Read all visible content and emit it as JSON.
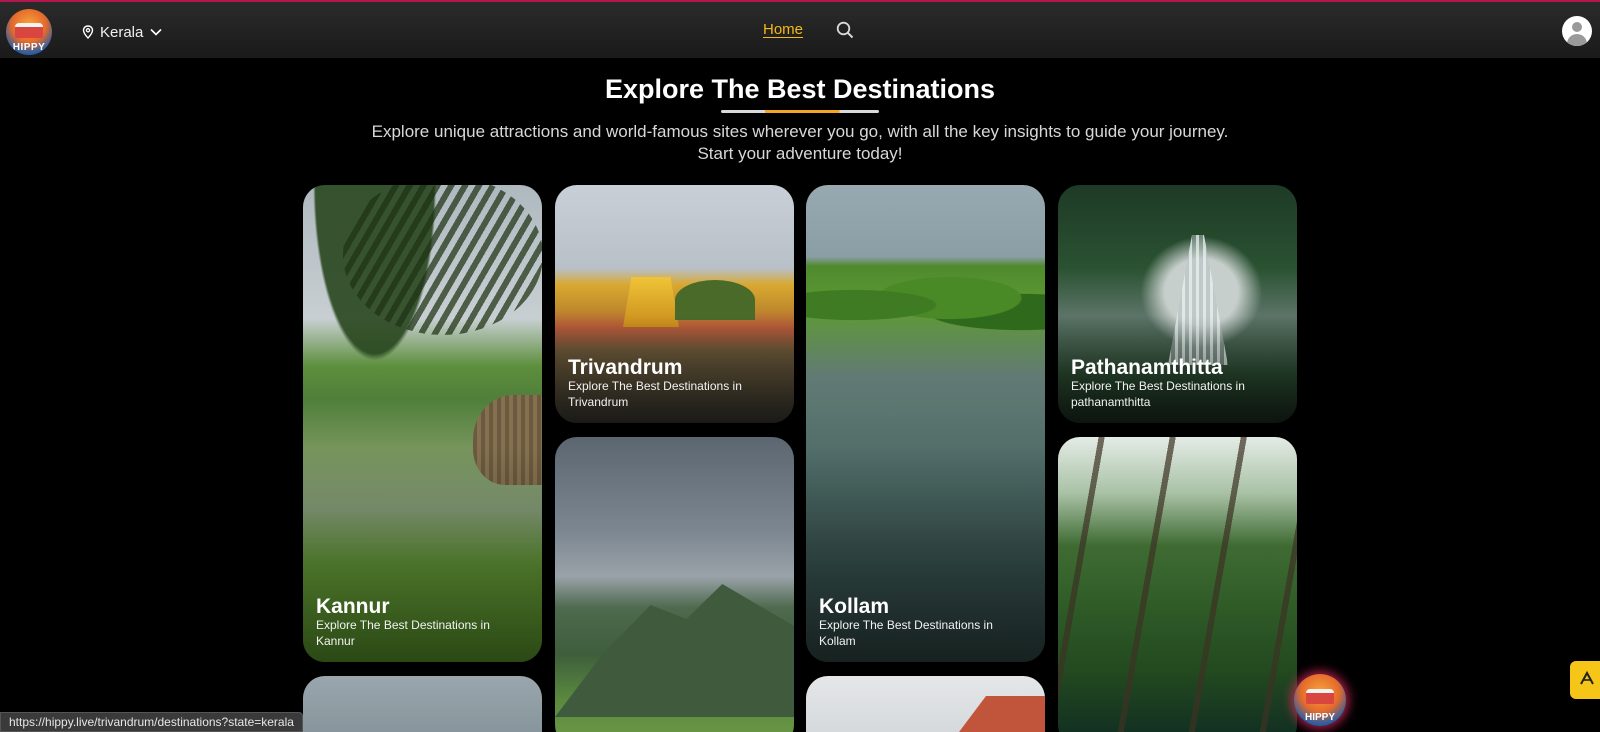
{
  "app": {
    "logo_text": "HIPPY"
  },
  "navbar": {
    "location": "Kerala",
    "home_label": "Home",
    "accent_color": "#f5b915",
    "icons": [
      "location-pin-icon",
      "chevron-down-icon",
      "search-icon",
      "user-avatar-icon"
    ]
  },
  "hero": {
    "title": "Explore The Best Destinations",
    "subtitle_line1": "Explore unique attractions and world-famous sites wherever you go, with all the key insights to guide your journey.",
    "subtitle_line2": "Start your adventure today!"
  },
  "destinations": [
    {
      "name": "Kannur",
      "description": "Explore The Best Destinations in Kannur"
    },
    {
      "name": "Trivandrum",
      "description": "Explore The Best Destinations in Trivandrum"
    },
    {
      "name": "Kollam",
      "description": "Explore The Best Destinations in Kollam"
    },
    {
      "name": "Pathanamthitta",
      "description": "Explore The Best Destinations in pathanamthitta"
    }
  ],
  "floating": {
    "chat_logo_text": "HIPPY",
    "side_button_icon": "triangle-a-icon"
  },
  "status_bar": {
    "url": "https://hippy.live/trivandrum/destinations?state=kerala"
  }
}
